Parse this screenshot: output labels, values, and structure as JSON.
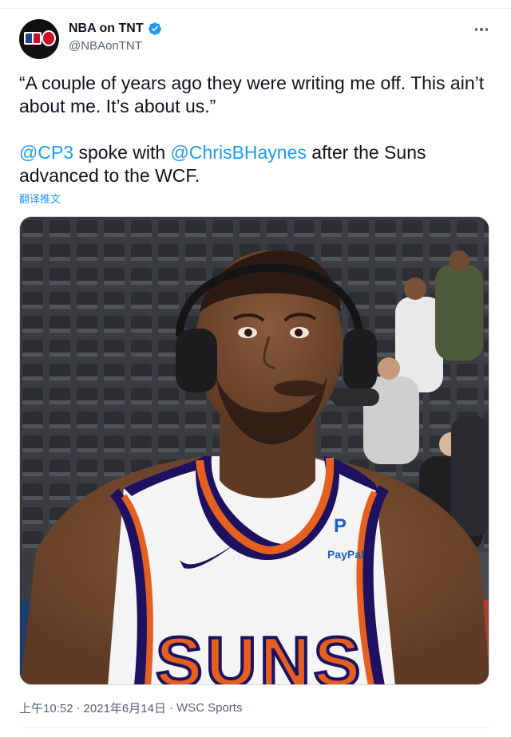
{
  "tweet": {
    "author": {
      "display_name": "NBA on TNT",
      "handle": "@NBAonTNT",
      "verified": true,
      "avatar_icon": "nba-on-tnt-logo"
    },
    "text": {
      "quote_line": "“A couple of years ago they were writing me off. This ain’t about me. It’s about us.”",
      "mention_1": "@CP3",
      "mid_text": " spoke with ",
      "mention_2": "@ChrisBHaynes",
      "end_text": " after the Suns advanced to the WCF."
    },
    "translate_label": "翻译推文",
    "media": {
      "description_icon": "player-interview-photo",
      "jersey_text": "SUNS",
      "sponsor_text": "PayPal"
    },
    "meta": {
      "time": "上午10:52",
      "separator": "·",
      "date": "2021年6月14日",
      "source": "WSC Sports"
    },
    "more_icon": "more-options-icon"
  },
  "colors": {
    "link": "#1d9bf0",
    "text": "#0f1419",
    "secondary": "#536471",
    "suns_orange": "#e56020",
    "suns_purple": "#1d1160"
  }
}
